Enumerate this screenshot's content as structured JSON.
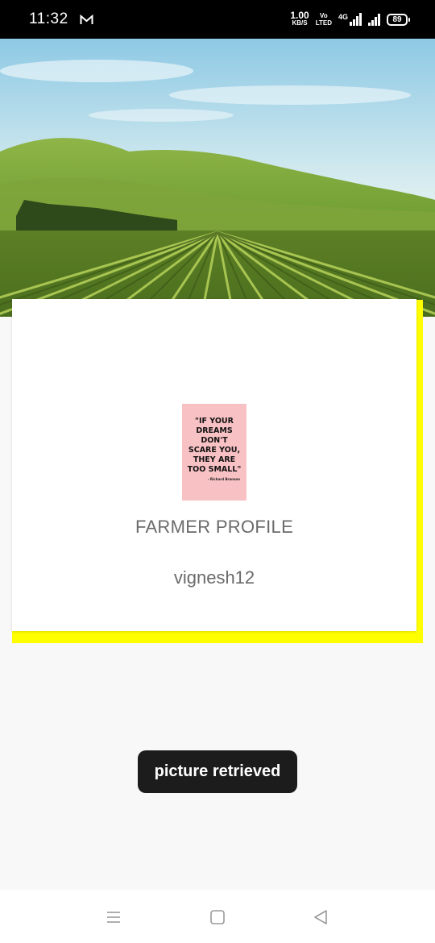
{
  "status_bar": {
    "time": "11:32",
    "net_speed_value": "1.00",
    "net_speed_unit": "KB/S",
    "volte_top": "Vo",
    "volte_bottom": "LTED",
    "signal_label": "4G",
    "battery": "89",
    "icons": [
      "mail-icon",
      "signal-icon",
      "battery-icon"
    ]
  },
  "hero": {
    "icon": "farm-landscape-image"
  },
  "profile_card": {
    "quote_text": "\"IF YOUR DREAMS DON'T SCARE YOU, THEY ARE TOO SMALL\"",
    "quote_author": "- Richard Branson",
    "title": "FARMER PROFILE",
    "username": "vignesh12",
    "accent_color": "#ffff00"
  },
  "toast": {
    "message": "picture retrieved"
  },
  "nav_bar": {
    "icons": [
      "menu-icon",
      "home-icon",
      "back-icon"
    ]
  }
}
